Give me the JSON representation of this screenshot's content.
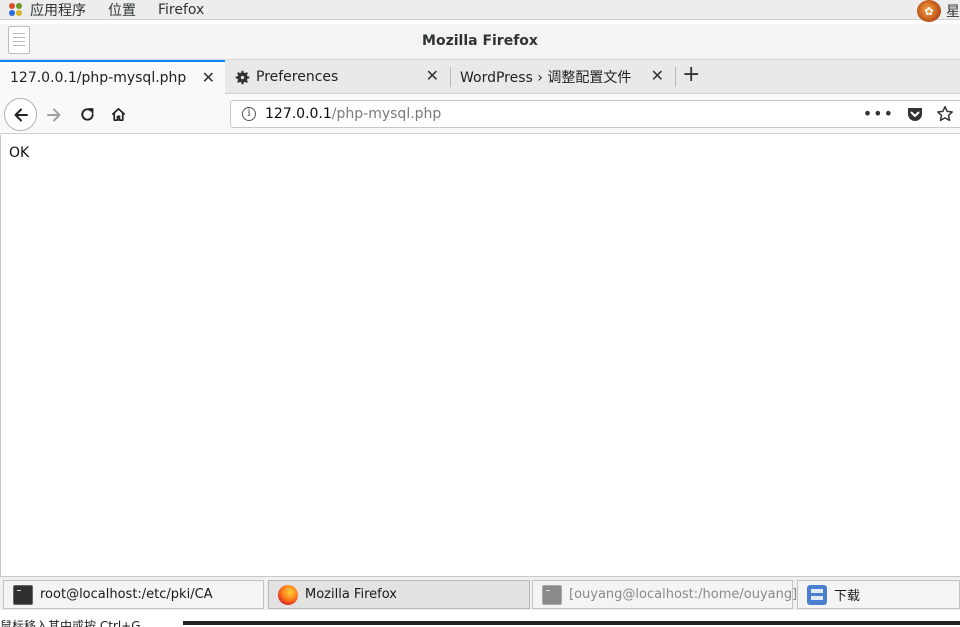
{
  "top_bar": {
    "menus": [
      "应用程序",
      "位置",
      "Firefox"
    ],
    "right_glyph": "星"
  },
  "window": {
    "title": "Mozilla Firefox"
  },
  "tabs": [
    {
      "label": "127.0.0.1/php-mysql.php",
      "active": true,
      "icon": "none"
    },
    {
      "label": "Preferences",
      "active": false,
      "icon": "gear-icon"
    },
    {
      "label": "WordPress › 调整配置文件",
      "active": false,
      "icon": "none"
    }
  ],
  "url_bar": {
    "host": "127.0.0.1",
    "path": "/php-mysql.php"
  },
  "page": {
    "body_text": "OK"
  },
  "taskbar": {
    "items": [
      {
        "label": "root@localhost:/etc/pki/CA",
        "icon": "terminal-icon"
      },
      {
        "label": "Mozilla Firefox",
        "icon": "firefox-icon"
      },
      {
        "label": "[ouyang@localhost:/home/ouyang]",
        "icon": "terminal-icon"
      },
      {
        "label": "下载",
        "icon": "files-icon"
      }
    ]
  },
  "status_line": {
    "text": "鼠标移入其中或按 Ctrl+G"
  },
  "colors": {
    "accent": "#0a84ff",
    "toolbar_bg": "#f9f9fa",
    "tabstrip_bg": "#e9e9ec"
  }
}
